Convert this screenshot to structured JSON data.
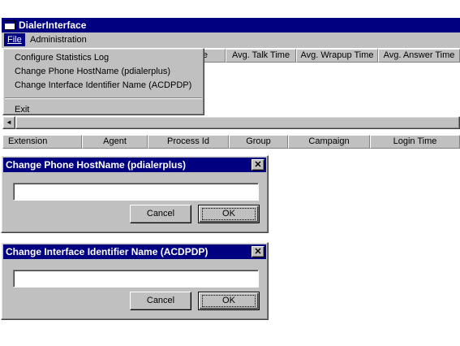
{
  "window": {
    "title": "DialerInterface"
  },
  "menubar": {
    "file": "File",
    "administration": "Administration"
  },
  "file_menu": {
    "items": [
      "Configure Statistics Log",
      "Change Phone HostName (pdialerplus)",
      "Change Interface Identifier Name (ACDPDP)"
    ],
    "exit": "Exit"
  },
  "stats_table": {
    "columns": [
      "Time",
      "Avg. Talk Time",
      "Avg. Wrapup Time",
      "Avg. Answer Time"
    ]
  },
  "agent_table": {
    "columns": [
      "Extension",
      "Agent",
      "Process Id",
      "Group",
      "Campaign",
      "Login Time"
    ]
  },
  "dialog_host": {
    "title": "Change Phone HostName (pdialerplus)",
    "value": "",
    "cancel": "Cancel",
    "ok": "OK"
  },
  "dialog_iface": {
    "title": "Change Interface Identifier Name (ACDPDP)",
    "value": "",
    "cancel": "Cancel",
    "ok": "OK"
  },
  "scrollbar": {
    "left_arrow": "◄"
  }
}
